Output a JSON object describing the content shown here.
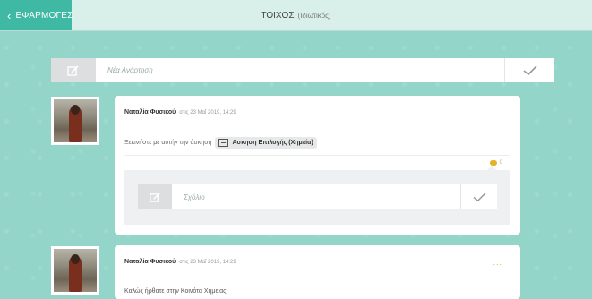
{
  "header": {
    "back_label": "ΕΦΑΡΜΟΓΕΣ",
    "title": "ΤΟΙΧΟΣ",
    "subtitle": "(Ιδιωτικός)"
  },
  "new_post": {
    "placeholder": "Νέα Ανάρτηση"
  },
  "posts": [
    {
      "author": "Ναταλία Φυσικού",
      "date": "στις 23 Μαΐ 2019, 14:29",
      "more": "...",
      "text": "Ξεκινήστε με αυτήν την άσκηση",
      "attachment": "Ασκηση Επιλογής (Χημεία)",
      "comment_count": "0",
      "comment_placeholder": "Σχόλιο"
    },
    {
      "author": "Ναταλία Φυσικού",
      "date": "στις 23 Μαΐ 2019, 14:29",
      "more": "...",
      "text": "Καλώς ήρθατε στην Κοινότα Χημείας!"
    }
  ],
  "colors": {
    "accent": "#3fb8a4",
    "background": "#93d6c9",
    "more_dots": "#e3b227"
  },
  "icons": {
    "back": "chevron-left-icon",
    "compose": "compose-icon",
    "submit": "check-icon",
    "comments": "speech-bubble-icon",
    "attachment": "exercise-icon"
  }
}
